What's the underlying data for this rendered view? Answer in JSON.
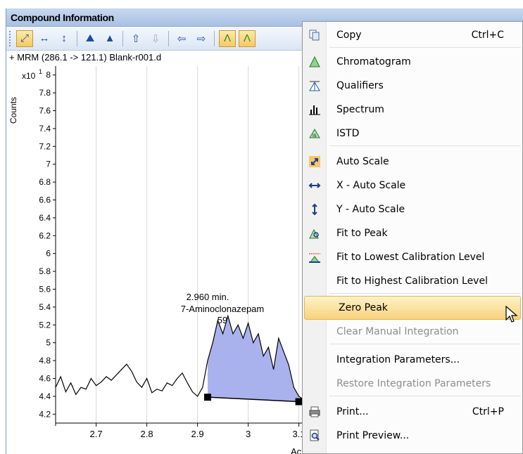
{
  "window": {
    "title": "Compound Information"
  },
  "plot": {
    "title": "+ MRM (286.1 -> 121.1) Blank-r001.d",
    "y_axis_label": "Counts",
    "y_exponent": "x10",
    "y_exponent_power": "1",
    "x_axis_label": "Ac",
    "peak_label_time": "2.960 min.",
    "peak_label_name": "7-Aminoclonazepam",
    "peak_label_area": "59"
  },
  "chart_data": {
    "type": "line",
    "ylim": [
      4.1,
      8.1
    ],
    "xlim": [
      2.62,
      3.12
    ],
    "y_ticks": [
      "8",
      "7.8",
      "7.6",
      "7.4",
      "7.2",
      "7",
      "6.8",
      "6.6",
      "6.4",
      "6.2",
      "6",
      "5.8",
      "5.6",
      "5.4",
      "5.2",
      "5",
      "4.8",
      "4.6",
      "4.4",
      "4.2"
    ],
    "x_ticks": [
      "2.7",
      "2.8",
      "2.9",
      "3",
      "3.1"
    ],
    "series": [
      {
        "x": [
          2.62,
          2.63,
          2.64,
          2.65,
          2.66,
          2.67,
          2.68,
          2.69,
          2.7,
          2.71,
          2.72,
          2.73,
          2.74,
          2.75,
          2.76,
          2.77,
          2.78,
          2.79,
          2.8,
          2.81,
          2.82,
          2.83,
          2.84,
          2.85,
          2.86,
          2.87,
          2.88,
          2.89,
          2.9,
          2.91,
          2.92,
          2.93,
          2.94,
          2.95,
          2.96,
          2.97,
          2.98,
          2.99,
          3.0,
          3.01,
          3.02,
          3.03,
          3.04,
          3.05,
          3.06,
          3.07,
          3.08,
          3.09,
          3.1,
          3.11,
          3.12
        ],
        "y": [
          4.5,
          4.62,
          4.45,
          4.55,
          4.42,
          4.5,
          4.48,
          4.6,
          4.52,
          4.56,
          4.62,
          4.58,
          4.64,
          4.7,
          4.76,
          4.68,
          4.56,
          4.5,
          4.6,
          4.44,
          4.48,
          4.46,
          4.55,
          4.52,
          4.6,
          4.66,
          4.55,
          4.45,
          4.4,
          4.5,
          4.8,
          5.0,
          5.25,
          5.1,
          5.3,
          5.1,
          5.2,
          5.05,
          5.22,
          5.0,
          5.1,
          4.85,
          4.95,
          4.7,
          5.05,
          4.9,
          4.75,
          4.5,
          4.4,
          4.36,
          4.33
        ]
      }
    ],
    "integration": {
      "start": {
        "x": 2.92,
        "y": 4.39
      },
      "end": {
        "x": 3.1,
        "y": 4.34
      },
      "fill_color": "#aab2ee"
    }
  },
  "toolbar": {
    "buttons": [
      {
        "name": "auto-scale-icon",
        "glyph": "⤢",
        "active": true
      },
      {
        "name": "x-auto-scale-icon",
        "glyph": "↔",
        "active": false
      },
      {
        "name": "y-auto-scale-icon",
        "glyph": "↕",
        "active": false
      },
      {
        "name": "fit-to-peak-icon",
        "glyph": "⛰",
        "active": false
      },
      {
        "name": "fit-to-lowest-calibration-icon",
        "glyph": "▲",
        "active": false
      },
      {
        "name": "prev-compound-icon",
        "glyph": "⇧",
        "active": false
      },
      {
        "name": "next-compound-icon",
        "glyph": "⇩",
        "active": false
      },
      {
        "name": "prev-sample-icon",
        "glyph": "⇦",
        "active": false
      },
      {
        "name": "next-sample-icon",
        "glyph": "⇨",
        "active": false
      },
      {
        "name": "chromatogram-icon",
        "glyph": "Λ",
        "active": true
      },
      {
        "name": "qualifiers-icon",
        "glyph": "Λ",
        "active": true
      }
    ]
  },
  "context_menu": {
    "items": [
      {
        "label": "Copy",
        "shortcut": "Ctrl+C",
        "icon": "copy-icon",
        "state": "normal"
      },
      {
        "label": "Chromatogram",
        "shortcut": "",
        "icon": "chromatogram-icon",
        "state": "normal"
      },
      {
        "label": "Qualifiers",
        "shortcut": "",
        "icon": "qualifiers-icon",
        "state": "normal"
      },
      {
        "label": "Spectrum",
        "shortcut": "",
        "icon": "spectrum-icon",
        "state": "normal"
      },
      {
        "label": "ISTD",
        "shortcut": "",
        "icon": "istd-icon",
        "state": "normal"
      },
      {
        "label": "Auto Scale",
        "shortcut": "",
        "icon": "auto-scale-icon",
        "state": "normal"
      },
      {
        "label": "X - Auto Scale",
        "shortcut": "",
        "icon": "x-auto-scale-icon",
        "state": "normal"
      },
      {
        "label": "Y - Auto Scale",
        "shortcut": "",
        "icon": "y-auto-scale-icon",
        "state": "normal"
      },
      {
        "label": "Fit to Peak",
        "shortcut": "",
        "icon": "fit-to-peak-icon",
        "state": "normal"
      },
      {
        "label": "Fit to Lowest Calibration Level",
        "shortcut": "",
        "icon": "fit-lowest-calibration-icon",
        "state": "normal"
      },
      {
        "label": "Fit to Highest Calibration Level",
        "shortcut": "",
        "icon": "",
        "state": "normal"
      },
      {
        "label": "Zero Peak",
        "shortcut": "",
        "icon": "",
        "state": "highlighted"
      },
      {
        "label": "Clear Manual Integration",
        "shortcut": "",
        "icon": "",
        "state": "disabled"
      },
      {
        "label": "Integration Parameters...",
        "shortcut": "",
        "icon": "",
        "state": "normal"
      },
      {
        "label": "Restore Integration Parameters",
        "shortcut": "",
        "icon": "",
        "state": "disabled"
      },
      {
        "label": "Print...",
        "shortcut": "Ctrl+P",
        "icon": "print-icon",
        "state": "normal"
      },
      {
        "label": "Print Preview...",
        "shortcut": "",
        "icon": "print-preview-icon",
        "state": "normal"
      }
    ]
  }
}
